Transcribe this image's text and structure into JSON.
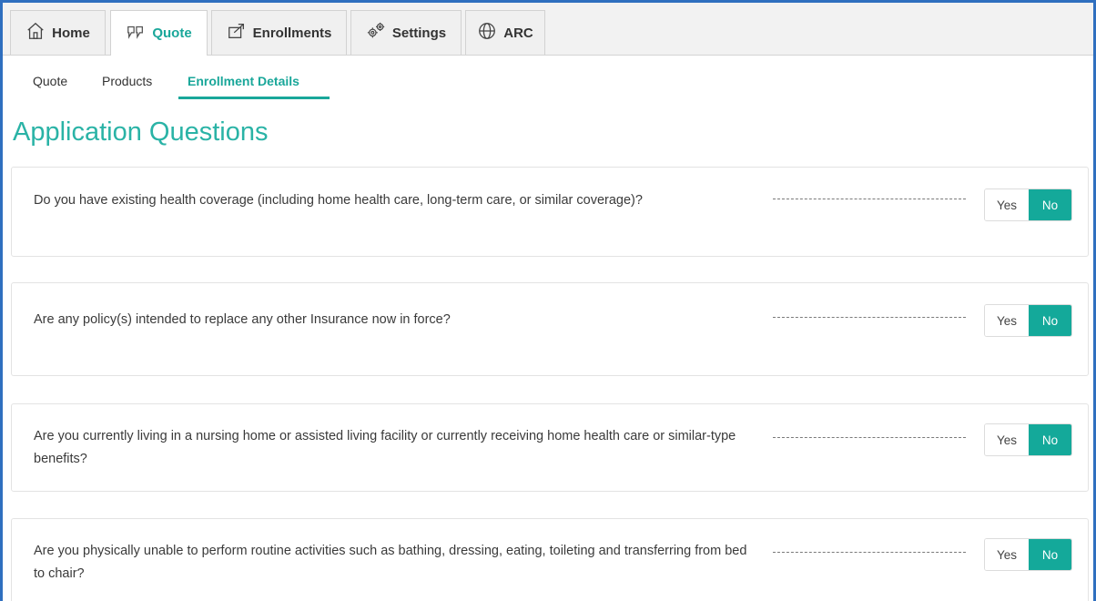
{
  "top_tabs": [
    {
      "label": "Home",
      "icon": "home-icon"
    },
    {
      "label": "Quote",
      "icon": "quote-icon"
    },
    {
      "label": "Enrollments",
      "icon": "enrollments-icon"
    },
    {
      "label": "Settings",
      "icon": "gear-icon"
    },
    {
      "label": "ARC",
      "icon": "globe-icon"
    }
  ],
  "active_top_tab": "Quote",
  "sub_tabs": [
    "Quote",
    "Products",
    "Enrollment Details"
  ],
  "active_sub_tab": "Enrollment Details",
  "page_title": "Application Questions",
  "questions": [
    {
      "text": "Do you have existing health coverage (including home health care, long-term care, or similar coverage)?",
      "yes_label": "Yes",
      "no_label": "No",
      "selected": "No"
    },
    {
      "text": "Are any policy(s) intended to replace any other Insurance now in force?",
      "yes_label": "Yes",
      "no_label": "No",
      "selected": "No"
    },
    {
      "text": "Are you currently living in a nursing home or assisted living facility or currently receiving home health care or similar-type benefits?",
      "yes_label": "Yes",
      "no_label": "No",
      "selected": "No"
    },
    {
      "text": "Are you physically unable to perform routine activities such as bathing, dressing, eating, toileting and transferring from bed to chair?",
      "yes_label": "Yes",
      "no_label": "No",
      "selected": "No"
    }
  ],
  "colors": {
    "accent": "#1aa79a",
    "toggle_selected": "#14a99a",
    "frame_border": "#2f6fbf"
  }
}
